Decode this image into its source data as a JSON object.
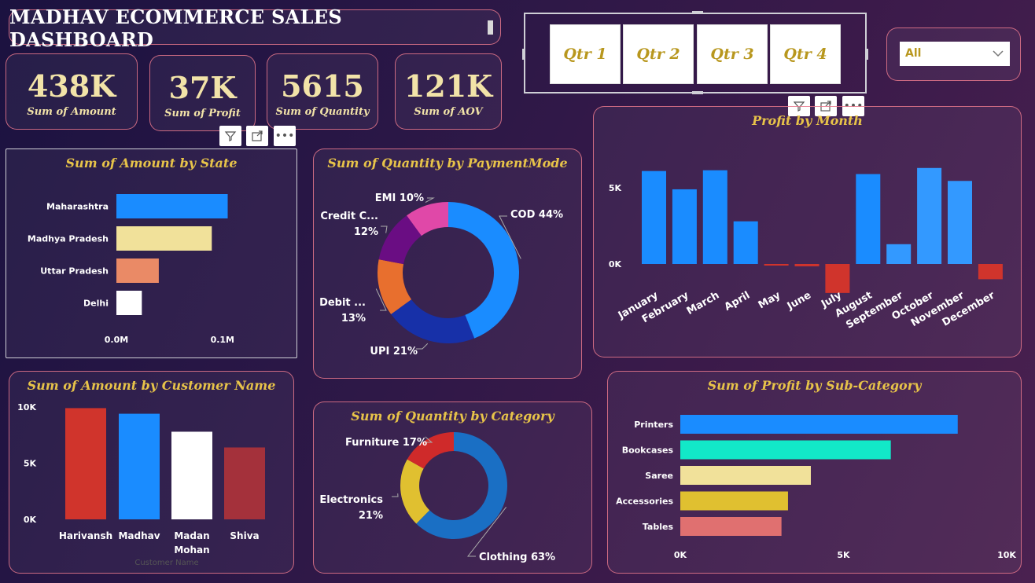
{
  "title": "MADHAV ECOMMERCE SALES DASHBOARD",
  "kpis": [
    {
      "value": "438K",
      "label": "Sum of Amount"
    },
    {
      "value": "37K",
      "label": "Sum of Profit"
    },
    {
      "value": "5615",
      "label": "Sum of Quantity"
    },
    {
      "value": "121K",
      "label": "Sum of AOV"
    }
  ],
  "quarter_slicer": {
    "options": [
      "Qtr 1",
      "Qtr 2",
      "Qtr 3",
      "Qtr 4"
    ]
  },
  "state_filter": {
    "selected": "All"
  },
  "colors": {
    "accent_gold": "#e7c349",
    "kpi_text": "#f2e3a8",
    "border": "#e8788c"
  },
  "chart_data": [
    {
      "id": "state",
      "type": "bar",
      "orientation": "horizontal",
      "title": "Sum of Amount by State",
      "categories": [
        "Maharashtra",
        "Madhya Pradesh",
        "Uttar Pradesh",
        "Delhi"
      ],
      "values": [
        0.105,
        0.09,
        0.04,
        0.024
      ],
      "colors": [
        "#1a8cff",
        "#f1e19a",
        "#ea8a66",
        "#ffffff"
      ],
      "xticks": [
        "0.0M",
        "0.1M"
      ],
      "xlim": [
        0,
        0.115
      ]
    },
    {
      "id": "payment",
      "type": "pie",
      "subtype": "donut",
      "title": "Sum of Quantity by PaymentMode",
      "slices": [
        {
          "label": "COD 44%",
          "pct": 44,
          "color": "#1a8cff"
        },
        {
          "label": "UPI 21%",
          "pct": 21,
          "color": "#1730a8"
        },
        {
          "label": "Debit ...",
          "label2": "13%",
          "pct": 13,
          "color": "#e86f2e"
        },
        {
          "label": "Credit C...",
          "label2": "12%",
          "pct": 12,
          "color": "#6a0d83"
        },
        {
          "label": "EMI 10%",
          "pct": 10,
          "color": "#e048a8"
        }
      ]
    },
    {
      "id": "month",
      "type": "bar",
      "title": "Profit by Month",
      "categories": [
        "January",
        "February",
        "March",
        "April",
        "May",
        "June",
        "July",
        "August",
        "September",
        "October",
        "November",
        "December"
      ],
      "values": [
        6100,
        4900,
        6150,
        2800,
        -100,
        -150,
        -1900,
        5900,
        1300,
        6300,
        5450,
        -1000
      ],
      "yticks": [
        {
          "v": 0,
          "label": "0K"
        },
        {
          "v": 5000,
          "label": "5K"
        }
      ],
      "colors": {
        "positive": "#1a8cff",
        "positive_light": "#3399ff",
        "negative": "#d0342c"
      }
    },
    {
      "id": "customer",
      "type": "bar",
      "title": "Sum of Amount by Customer Name",
      "categories": [
        "Harivansh",
        "Madhav",
        "Madan Mohan",
        "Shiva"
      ],
      "values": [
        9900,
        9400,
        7800,
        6400
      ],
      "colors": [
        "#d0342c",
        "#1a8cff",
        "#ffffff",
        "#a4313b"
      ],
      "yticks": [
        {
          "v": 0,
          "label": "0K"
        },
        {
          "v": 5000,
          "label": "5K"
        },
        {
          "v": 10000,
          "label": "10K"
        }
      ],
      "xlabel": "Customer Name"
    },
    {
      "id": "category",
      "type": "pie",
      "subtype": "donut",
      "title": "Sum of Quantity by Category",
      "slices": [
        {
          "label": "Clothing 63%",
          "pct": 63,
          "color": "#1a6fc4"
        },
        {
          "label": "Electronics",
          "label2": "21%",
          "pct": 21,
          "color": "#e0c030"
        },
        {
          "label": "Furniture 17%",
          "pct": 17,
          "color": "#cf2a2a"
        }
      ]
    },
    {
      "id": "subcat",
      "type": "bar",
      "orientation": "horizontal",
      "title": "Sum of Profit by Sub-Category",
      "categories": [
        "Printers",
        "Bookcases",
        "Saree",
        "Accessories",
        "Tables"
      ],
      "values": [
        8500,
        6450,
        4000,
        3300,
        3100
      ],
      "colors": [
        "#1a8cff",
        "#12e8c8",
        "#f1e19a",
        "#e0c030",
        "#e07070"
      ],
      "xticks": [
        {
          "v": 0,
          "label": "0K"
        },
        {
          "v": 5000,
          "label": "5K"
        },
        {
          "v": 10000,
          "label": "10K"
        }
      ],
      "xlim": [
        0,
        10000
      ]
    }
  ]
}
